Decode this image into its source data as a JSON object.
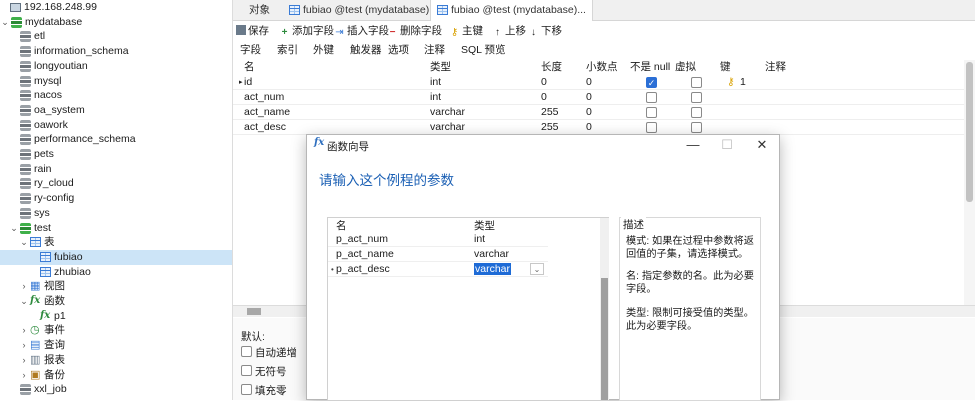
{
  "sidebar": {
    "server_top": "192.168.248.99",
    "items": [
      {
        "label": "mydatabase",
        "level": 0,
        "expanded": true,
        "icon": "database-green-icon"
      },
      {
        "label": "etl",
        "level": 1,
        "icon": "database-icon"
      },
      {
        "label": "information_schema",
        "level": 1,
        "icon": "database-icon"
      },
      {
        "label": "longyoutian",
        "level": 1,
        "icon": "database-icon"
      },
      {
        "label": "mysql",
        "level": 1,
        "icon": "database-icon"
      },
      {
        "label": "nacos",
        "level": 1,
        "icon": "database-icon"
      },
      {
        "label": "oa_system",
        "level": 1,
        "icon": "database-icon"
      },
      {
        "label": "oawork",
        "level": 1,
        "icon": "database-icon"
      },
      {
        "label": "performance_schema",
        "level": 1,
        "icon": "database-icon"
      },
      {
        "label": "pets",
        "level": 1,
        "icon": "database-icon"
      },
      {
        "label": "rain",
        "level": 1,
        "icon": "database-icon"
      },
      {
        "label": "ry_cloud",
        "level": 1,
        "icon": "database-icon"
      },
      {
        "label": "ry-config",
        "level": 1,
        "icon": "database-icon"
      },
      {
        "label": "sys",
        "level": 1,
        "icon": "database-icon"
      },
      {
        "label": "test",
        "level": 1,
        "expanded": true,
        "icon": "database-green-icon"
      },
      {
        "label": "表",
        "level": 2,
        "expanded": true,
        "icon": "table-folder-icon"
      },
      {
        "label": "fubiao",
        "level": 3,
        "selected": true,
        "icon": "table-icon"
      },
      {
        "label": "zhubiao",
        "level": 3,
        "icon": "table-icon"
      },
      {
        "label": "视图",
        "level": 2,
        "collapsed": true,
        "icon": "view-icon"
      },
      {
        "label": "函数",
        "level": 2,
        "expanded": true,
        "icon": "function-icon"
      },
      {
        "label": "p1",
        "level": 3,
        "icon": "function-icon"
      },
      {
        "label": "事件",
        "level": 2,
        "collapsed": true,
        "icon": "event-icon"
      },
      {
        "label": "查询",
        "level": 2,
        "collapsed": true,
        "icon": "query-icon"
      },
      {
        "label": "报表",
        "level": 2,
        "collapsed": true,
        "icon": "report-icon"
      },
      {
        "label": "备份",
        "level": 2,
        "collapsed": true,
        "icon": "backup-icon"
      },
      {
        "label": "xxl_job",
        "level": 1,
        "icon": "database-icon"
      }
    ]
  },
  "tabs": [
    {
      "label": "对象"
    },
    {
      "label": "fubiao @test (mydatabase)..."
    },
    {
      "label": "fubiao @test (mydatabase)...",
      "active": true
    }
  ],
  "toolbar": {
    "save": "保存",
    "add_field": "添加字段",
    "insert_field": "插入字段",
    "delete_field": "删除字段",
    "primary_key": "主键",
    "move_up": "上移",
    "move_down": "下移"
  },
  "subtabs": [
    "字段",
    "索引",
    "外键",
    "触发器",
    "选项",
    "注释",
    "SQL 预览"
  ],
  "grid": {
    "headers": [
      "名",
      "类型",
      "长度",
      "小数点",
      "不是 null",
      "虚拟",
      "键",
      "注释"
    ],
    "rows": [
      {
        "name": "id",
        "type": "int",
        "length": "0",
        "decimals": "0",
        "not_null": true,
        "virtual": false,
        "key": "1"
      },
      {
        "name": "act_num",
        "type": "int",
        "length": "0",
        "decimals": "0",
        "not_null": false,
        "virtual": false,
        "key": ""
      },
      {
        "name": "act_name",
        "type": "varchar",
        "length": "255",
        "decimals": "0",
        "not_null": false,
        "virtual": false,
        "key": ""
      },
      {
        "name": "act_desc",
        "type": "varchar",
        "length": "255",
        "decimals": "0",
        "not_null": false,
        "virtual": false,
        "key": ""
      }
    ]
  },
  "bottom": {
    "default_label": "默认:",
    "auto_increment": "自动递增",
    "unsigned": "无符号",
    "zerofill": "填充零"
  },
  "dialog": {
    "title": "函数向导",
    "heading": "请输入这个例程的参数",
    "headers": [
      "名",
      "类型"
    ],
    "params": [
      {
        "name": "p_act_num",
        "type": "int"
      },
      {
        "name": "p_act_name",
        "type": "varchar"
      },
      {
        "name": "p_act_desc",
        "type": "varchar",
        "editing": true
      }
    ],
    "desc_title": "描述",
    "desc": [
      "模式: 如果在过程中参数将返回值的子集，请选择模式。",
      "名: 指定参数的名。此为必要字段。",
      "类型: 限制可接受值的类型。此为必要字段。"
    ]
  },
  "colors": {
    "accent": "#1a5fb4",
    "selection": "#cce4f7",
    "checkbox_on": "#2b6fd6"
  }
}
